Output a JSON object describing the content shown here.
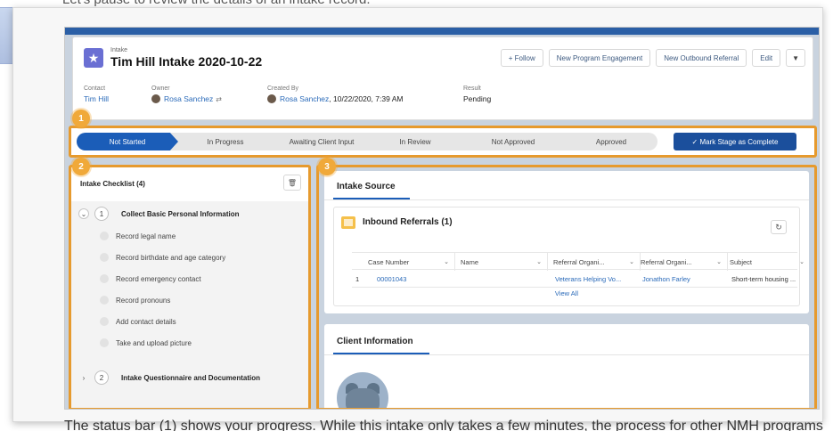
{
  "document": {
    "top_text": "Let's pause to review the details of an intake record.",
    "bottom_text": "The status bar (1) shows your progress. While this intake only takes a few minutes, the process for other NMH programs"
  },
  "record": {
    "object_label": "Intake",
    "title": "Tim Hill Intake 2020-10-22",
    "icon": "star-icon",
    "buttons": {
      "follow": "+ Follow",
      "new_program_engagement": "New Program Engagement",
      "new_outbound_referral": "New Outbound Referral",
      "edit": "Edit",
      "more": "▼"
    },
    "fields": {
      "contact_label": "Contact",
      "contact_value": "Tim Hill",
      "owner_label": "Owner",
      "owner_value": "Rosa Sanchez",
      "created_by_label": "Created By",
      "created_by_value": "Rosa Sanchez",
      "created_by_date": ", 10/22/2020, 7:39 AM",
      "result_label": "Result",
      "result_value": "Pending"
    }
  },
  "callouts": {
    "one": "1",
    "two": "2",
    "three": "3"
  },
  "stages": {
    "items": [
      "Not Started",
      "In Progress",
      "Awaiting Client Input",
      "In Review",
      "Not Approved",
      "Approved"
    ],
    "active": "Not Started",
    "mark_complete": "✓  Mark Stage as Complete"
  },
  "checklist": {
    "title": "Intake Checklist (4)",
    "group1": {
      "number": "1",
      "title": "Collect Basic Personal Information"
    },
    "items": [
      "Record legal name",
      "Record birthdate and age category",
      "Record emergency contact",
      "Record pronouns",
      "Add contact details",
      "Take and upload picture"
    ],
    "group2": {
      "number": "2",
      "title": "Intake Questionnaire and Documentation"
    }
  },
  "intake_source": {
    "tab": "Intake Source",
    "related_title": "Inbound Referrals (1)",
    "columns": [
      "Case Number",
      "Name",
      "Referral Organi...",
      "Referral Organi...",
      "Subject"
    ],
    "rows": [
      {
        "index": "1",
        "case_number": "00001043",
        "name": "",
        "org1": "Veterans Helping Vo...",
        "org2": "Jonathon Farley",
        "subject": "Short-term housing ..."
      }
    ],
    "view_all": "View All"
  },
  "client_info": {
    "tab": "Client Information"
  },
  "colors": {
    "brand_blue": "#1b5db8",
    "callout_orange": "#e69a2e",
    "record_icon": "#6a6fd3"
  }
}
